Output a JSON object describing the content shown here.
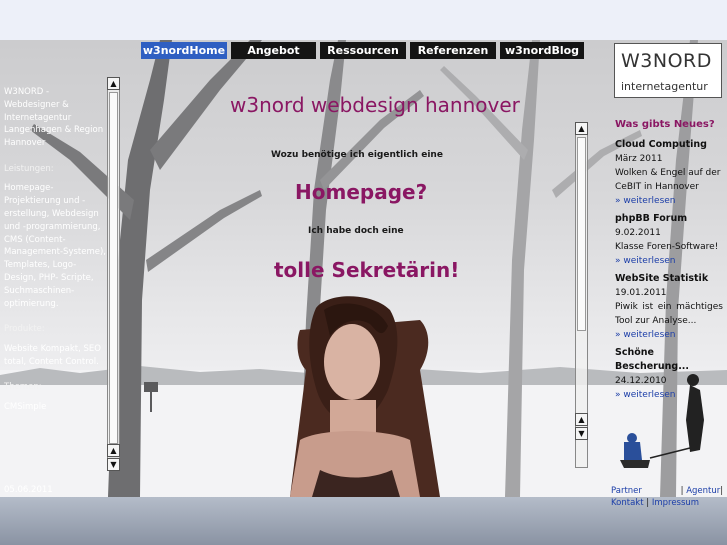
{
  "nav": {
    "items": [
      {
        "label": "w3nordHome",
        "active": true
      },
      {
        "label": "Angebot",
        "active": false
      },
      {
        "label": "Ressourcen",
        "active": false
      },
      {
        "label": "Referenzen",
        "active": false
      },
      {
        "label": "w3nordBlog",
        "active": false
      }
    ]
  },
  "logo": {
    "line1": "W3NORD",
    "line2": "internetagentur"
  },
  "left": {
    "intro": "W3NORD - Webdesigner & Internetagentur Langenhagen & Region Hannover",
    "services_heading": "Leistungen:",
    "services": "Homepage-Projektierung und -erstellung, Webdesign und -programmierung, CMS (Content-Management-Systeme), Templates, Logo- Design, PHP- Scripte, Suchmaschinen-optimierung.",
    "products_heading": "Produkte:",
    "products": "Website Kompakt, SEO total, Content Control.",
    "themes_heading": "Themen:",
    "themes": "CMSimple",
    "date": "05.06.2011"
  },
  "center": {
    "title": "w3nord webdesign hannover",
    "line1": "Wozu benötige ich eigentlich eine",
    "big1": "Homepage?",
    "line2": "Ich habe doch eine",
    "big2": "tolle Sekretärin!"
  },
  "news": {
    "heading": "Was gibts Neues?",
    "items": [
      {
        "title": "Cloud Computing",
        "date": "März 2011",
        "text": "Wolken & Engel auf der CeBIT in Hannover",
        "more": "» weiterlesen"
      },
      {
        "title": "phpBB Forum",
        "date": "9.02.2011",
        "text": "Klasse Foren-Software!",
        "more": "» weiterlesen"
      },
      {
        "title": "WebSite Statistik",
        "date": "19.01.2011",
        "text": "Piwik ist ein mächtiges Tool zur Analyse...",
        "more": "» weiterlesen"
      },
      {
        "title": "Schöne Bescherung...",
        "date": "24.12.2010",
        "text": "",
        "more": "» weiterlesen"
      }
    ]
  },
  "footer": {
    "partner": "Partner",
    "agentur": "Agentur",
    "kontakt": "Kontakt",
    "impressum": "Impressum"
  },
  "colors": {
    "accent": "#8a1763",
    "nav_active": "#2f5fc2",
    "nav_bg": "#141414",
    "link": "#1c3ea8"
  },
  "icons": {
    "scroll_up": "triangle-up",
    "scroll_down": "triangle-down"
  }
}
